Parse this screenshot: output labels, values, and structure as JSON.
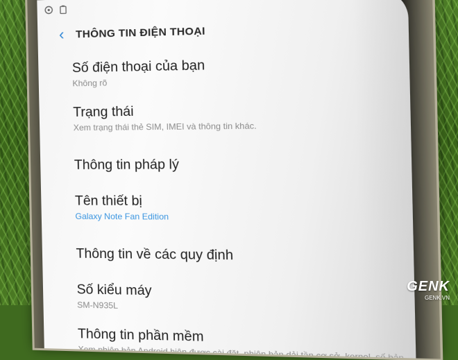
{
  "status_icons": [
    "circle-settings-icon",
    "battery-icon"
  ],
  "header": {
    "back_icon": "chevron-left-icon",
    "title": "THÔNG TIN ĐIỆN THOẠI"
  },
  "items": [
    {
      "label": "Số điện thoại của bạn",
      "sub": "Không rõ"
    },
    {
      "label": "Trạng thái",
      "sub": "Xem trạng thái thẻ SIM, IMEI và thông tin khác."
    },
    {
      "label": "Thông tin pháp lý",
      "sub": ""
    },
    {
      "label": "Tên thiết bị",
      "sub": "Galaxy Note Fan Edition"
    },
    {
      "label": "Thông tin về các quy định",
      "sub": ""
    },
    {
      "label": "Số kiểu máy",
      "sub": "SM-N935L"
    },
    {
      "label": "Thông tin phần mềm",
      "sub": "Xem phiên bản Android hiện được cài đặt, phiên bản dải tần cơ sở, kernel, số bản dựng và thông tin khác."
    }
  ],
  "colors": {
    "accent": "#2f86d6",
    "link": "#3a95e0"
  },
  "watermark": {
    "logo": "GENK",
    "url": "GENK.VN"
  }
}
